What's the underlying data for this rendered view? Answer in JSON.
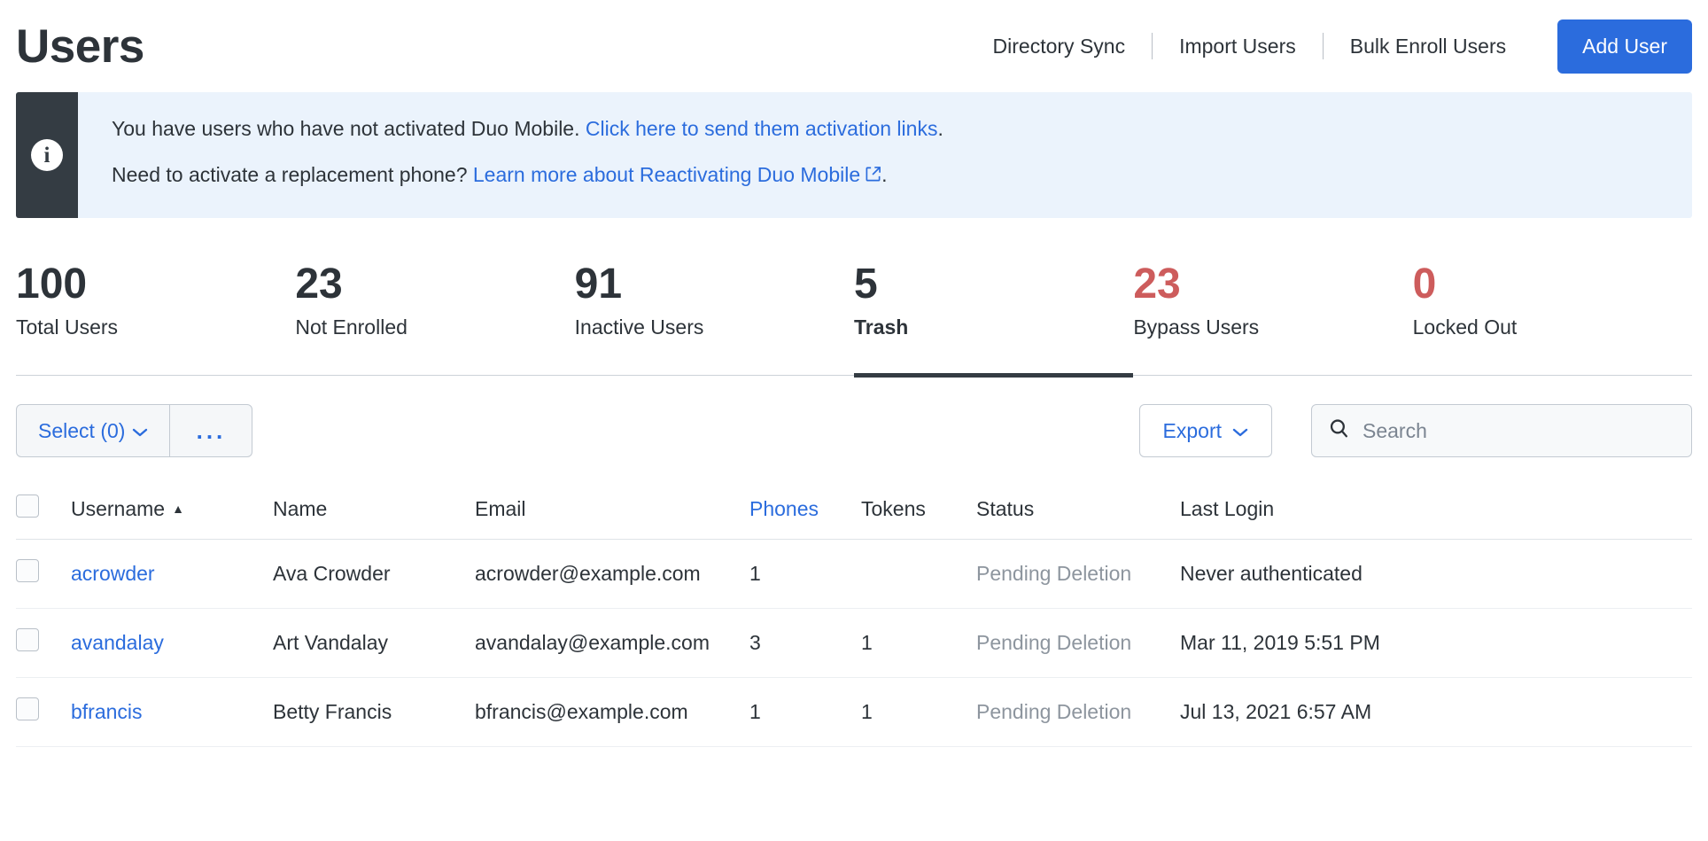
{
  "header": {
    "title": "Users",
    "links": [
      {
        "label": "Directory Sync"
      },
      {
        "label": "Import Users"
      },
      {
        "label": "Bulk Enroll Users"
      }
    ],
    "primary_button": "Add User"
  },
  "banner": {
    "icon": "info-icon",
    "line1_prefix": "You have users who have not activated Duo Mobile. ",
    "line1_link": "Click here to send them activation links",
    "line1_suffix": ".",
    "line2_prefix": "Need to activate a replacement phone? ",
    "line2_link": "Learn more about Reactivating Duo Mobile",
    "line2_suffix": ".",
    "bg_color": "#ebf3fc",
    "accent_color": "#343c43"
  },
  "stats": [
    {
      "value": "100",
      "label": "Total Users",
      "danger": false,
      "active": false
    },
    {
      "value": "23",
      "label": "Not Enrolled",
      "danger": false,
      "active": false
    },
    {
      "value": "91",
      "label": "Inactive Users",
      "danger": false,
      "active": false
    },
    {
      "value": "5",
      "label": "Trash",
      "danger": false,
      "active": true
    },
    {
      "value": "23",
      "label": "Bypass Users",
      "danger": true,
      "active": false
    },
    {
      "value": "0",
      "label": "Locked Out",
      "danger": true,
      "active": false
    }
  ],
  "toolbar": {
    "select_label": "Select (0)",
    "more_label": "...",
    "export_label": "Export",
    "search_placeholder": "Search",
    "search_value": ""
  },
  "table": {
    "columns": [
      {
        "key": "username",
        "label": "Username",
        "sorted": "asc",
        "link": false
      },
      {
        "key": "name",
        "label": "Name",
        "sorted": "",
        "link": false
      },
      {
        "key": "email",
        "label": "Email",
        "sorted": "",
        "link": false
      },
      {
        "key": "phones",
        "label": "Phones",
        "sorted": "",
        "link": true
      },
      {
        "key": "tokens",
        "label": "Tokens",
        "sorted": "",
        "link": false
      },
      {
        "key": "status",
        "label": "Status",
        "sorted": "",
        "link": false
      },
      {
        "key": "lastlogin",
        "label": "Last Login",
        "sorted": "",
        "link": false
      }
    ],
    "rows": [
      {
        "username": "acrowder",
        "name": "Ava Crowder",
        "email": "acrowder@example.com",
        "phones": "1",
        "tokens": "",
        "status": "Pending Deletion",
        "lastlogin": "Never authenticated"
      },
      {
        "username": "avandalay",
        "name": "Art Vandalay",
        "email": "avandalay@example.com",
        "phones": "3",
        "tokens": "1",
        "status": "Pending Deletion",
        "lastlogin": "Mar 11, 2019 5:51 PM"
      },
      {
        "username": "bfrancis",
        "name": "Betty Francis",
        "email": "bfrancis@example.com",
        "phones": "1",
        "tokens": "1",
        "status": "Pending Deletion",
        "lastlogin": "Jul 13, 2021 6:57 AM"
      }
    ]
  },
  "colors": {
    "accent_blue": "#2b6cdd",
    "danger_red": "#cd5c5c",
    "dark": "#343c43",
    "muted": "#8d959e"
  }
}
